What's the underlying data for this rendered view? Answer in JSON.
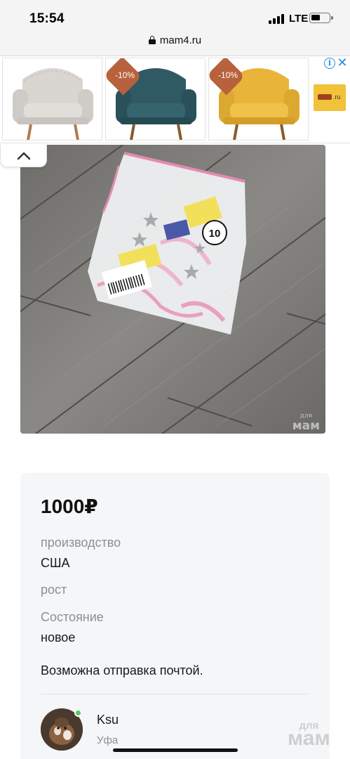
{
  "status_bar": {
    "time": "15:54",
    "network": "LTE"
  },
  "browser": {
    "url": "mam4.ru",
    "icons": {
      "lock": "lock-icon"
    }
  },
  "ad_banner": {
    "cards": [
      {
        "discount": "",
        "chair_color": "#d9d6d2"
      },
      {
        "discount": "-10%",
        "chair_color": "#2f5a63"
      },
      {
        "discount": "-10%",
        "chair_color": "#e8b53a"
      }
    ],
    "logo_text": ".ru",
    "icons": {
      "info": "info-icon",
      "close": "close-icon"
    }
  },
  "listing": {
    "price": "1000₽",
    "fields": [
      {
        "label": "производство",
        "value": "США"
      },
      {
        "label": "рост",
        "value": ""
      },
      {
        "label": "Состояние",
        "value": "новое"
      }
    ],
    "note": "Возможна отправка почтой.",
    "seller": {
      "name": "Ksu",
      "city": "Уфа",
      "online": true
    }
  },
  "photo": {
    "size_tag": "10",
    "watermark": "мам",
    "watermark_small": "для"
  },
  "colors": {
    "accent_blue": "#2a8be0",
    "badge_orange": "#b8613d",
    "online_green": "#5bc85b"
  }
}
